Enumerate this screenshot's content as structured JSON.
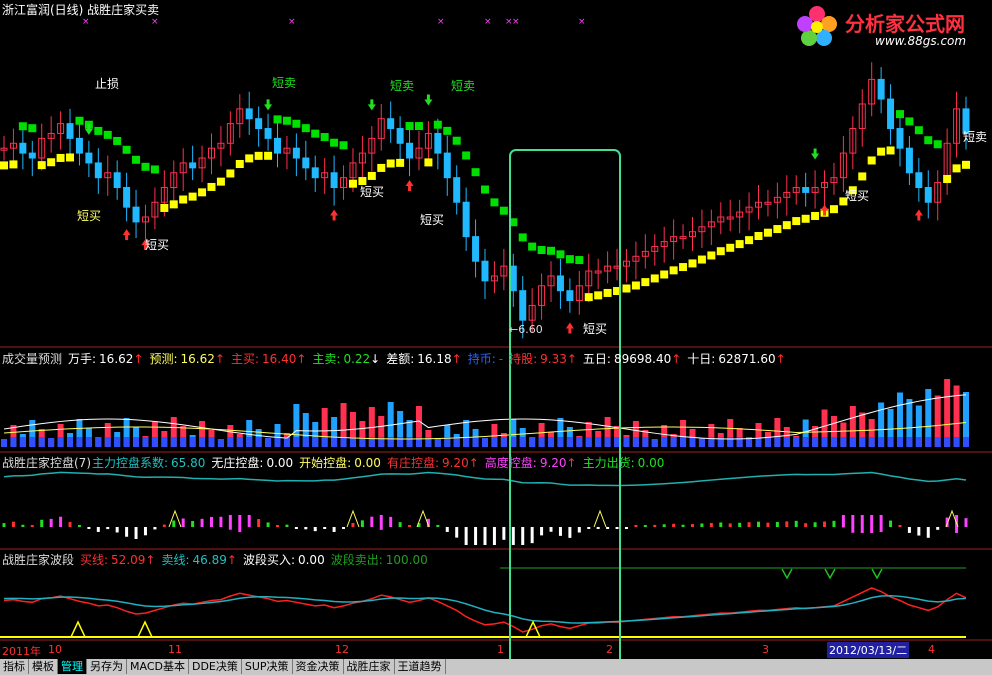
{
  "header": {
    "title": "浙江富润(日线) 战胜庄家买卖",
    "logo_text": "分析家公式网",
    "logo_url": "www.88gs.com"
  },
  "panel1": {
    "labels": [
      {
        "text": "止损",
        "color": "#ffffff"
      },
      {
        "text": "短卖",
        "color": "#20e020"
      },
      {
        "text": "短卖",
        "color": "#20e020"
      },
      {
        "text": "短卖",
        "color": "#20e020"
      },
      {
        "text": "短买",
        "color": "#ffff60"
      },
      {
        "text": "短买",
        "color": "#ffffff"
      },
      {
        "text": "短买",
        "color": "#ffffff"
      },
      {
        "text": "短买",
        "color": "#ffffff"
      },
      {
        "text": "短买",
        "color": "#ffffff"
      },
      {
        "text": "短买",
        "color": "#ffffff"
      },
      {
        "text": "短卖",
        "color": "#ffffff"
      }
    ],
    "low_mark": "←6.60"
  },
  "panel2": {
    "name": "成交量预测",
    "fields": [
      {
        "label": "万手:",
        "value": "16.62",
        "arrow": "↑",
        "label_color": "#ffffff",
        "value_color": "#ffffff"
      },
      {
        "label": "预测:",
        "value": "16.62",
        "arrow": "↑",
        "label_color": "#ffff60",
        "value_color": "#ffff60"
      },
      {
        "label": "主买:",
        "value": "16.40",
        "arrow": "↑",
        "label_color": "#ff3030",
        "value_color": "#ff3030"
      },
      {
        "label": "主卖:",
        "value": "0.22",
        "arrow": "↓",
        "label_color": "#20e020",
        "value_color": "#20e020"
      },
      {
        "label": "差额:",
        "value": "16.18",
        "arrow": "↑",
        "label_color": "#ffffff",
        "value_color": "#ffffff"
      },
      {
        "label": "持币:",
        "value": "-",
        "arrow": "",
        "label_color": "#3060ff",
        "value_color": "#3060ff"
      },
      {
        "label": "持股:",
        "value": "9.33",
        "arrow": "↑",
        "label_color": "#ff3030",
        "value_color": "#ff3030"
      },
      {
        "label": "五日:",
        "value": "89698.40",
        "arrow": "↑",
        "label_color": "#ffffff",
        "value_color": "#ffffff"
      },
      {
        "label": "十日:",
        "value": "62871.60",
        "arrow": "↑",
        "label_color": "#ffffff",
        "value_color": "#ffffff"
      }
    ]
  },
  "panel3": {
    "name": "战胜庄家控盘(7)",
    "fields": [
      {
        "label": "主力控盘系数:",
        "value": "65.80",
        "arrow": "",
        "label_color": "#20c0c0",
        "value_color": "#20c0c0"
      },
      {
        "label": "无庄控盘:",
        "value": "0.00",
        "arrow": "",
        "label_color": "#ffffff",
        "value_color": "#ffffff"
      },
      {
        "label": "开始控盘:",
        "value": "0.00",
        "arrow": "",
        "label_color": "#ffff60",
        "value_color": "#ffff60"
      },
      {
        "label": "有庄控盘:",
        "value": "9.20",
        "arrow": "↑",
        "label_color": "#ff3030",
        "value_color": "#ff3030"
      },
      {
        "label": "高度控盘:",
        "value": "9.20",
        "arrow": "↑",
        "label_color": "#ff40ff",
        "value_color": "#ff40ff"
      },
      {
        "label": "主力出货:",
        "value": "0.00",
        "arrow": "",
        "label_color": "#20e020",
        "value_color": "#20e020"
      }
    ]
  },
  "panel4": {
    "name": "战胜庄家波段",
    "fields": [
      {
        "label": "买线:",
        "value": "52.09",
        "arrow": "↑",
        "label_color": "#ff3030",
        "value_color": "#ff3030"
      },
      {
        "label": "卖线:",
        "value": "46.89",
        "arrow": "↑",
        "label_color": "#20c0c0",
        "value_color": "#20c0c0"
      },
      {
        "label": "波段买入:",
        "value": "0.00",
        "arrow": "",
        "label_color": "#ffffff",
        "value_color": "#ffffff"
      },
      {
        "label": "波段卖出:",
        "value": "100.00",
        "arrow": "",
        "label_color": "#20a020",
        "value_color": "#20a020"
      }
    ]
  },
  "xaxis": {
    "ticks": [
      "2011年",
      "10",
      "11",
      "12",
      "1",
      "2",
      "3",
      "4"
    ],
    "cursor_date": "2012/03/13/二"
  },
  "tabs": [
    "指标",
    "模板",
    "管理",
    "另存为",
    "MACD基本",
    "DDE决策",
    "SUP决策",
    "资金决策",
    "战胜庄家",
    "王道趋势"
  ],
  "active_tab": 2,
  "colors": {
    "up": "#ff3050",
    "down": "#20b8ff",
    "green_trend": "#00e000",
    "yellow_trend": "#ffff00",
    "highlight_box": "#40e090",
    "buy_line": "#ff2020",
    "sell_line": "#20b0c0"
  },
  "chart_data": {
    "type": "candlestick",
    "close": [
      8.1,
      8.2,
      8.0,
      7.9,
      8.3,
      8.4,
      8.6,
      8.3,
      8.0,
      7.8,
      7.5,
      7.6,
      7.3,
      6.9,
      6.6,
      6.7,
      7.0,
      7.3,
      7.6,
      7.8,
      7.7,
      7.9,
      8.1,
      8.2,
      8.6,
      8.9,
      8.7,
      8.5,
      8.3,
      8.0,
      8.1,
      7.9,
      7.7,
      7.5,
      7.6,
      7.3,
      7.5,
      7.8,
      8.0,
      8.3,
      8.7,
      8.5,
      8.2,
      7.9,
      8.1,
      8.4,
      8.0,
      7.5,
      7.0,
      6.3,
      5.8,
      5.4,
      5.5,
      5.7,
      5.2,
      4.6,
      4.9,
      5.3,
      5.5,
      5.2,
      5.0,
      5.3,
      5.6,
      5.6,
      5.7,
      5.7,
      5.8,
      5.9,
      6.0,
      6.1,
      6.2,
      6.3,
      6.3,
      6.4,
      6.5,
      6.6,
      6.7,
      6.7,
      6.8,
      6.9,
      7.0,
      7.0,
      7.1,
      7.2,
      7.3,
      7.2,
      7.3,
      7.4,
      7.5,
      8.0,
      8.5,
      9.0,
      9.5,
      9.1,
      8.5,
      8.1,
      7.6,
      7.3,
      7.0,
      7.4,
      8.2,
      8.9,
      8.4
    ],
    "ma_vol": [],
    "control_coef": 65.8,
    "buy_line_last": 52.09,
    "sell_line_last": 46.89
  }
}
